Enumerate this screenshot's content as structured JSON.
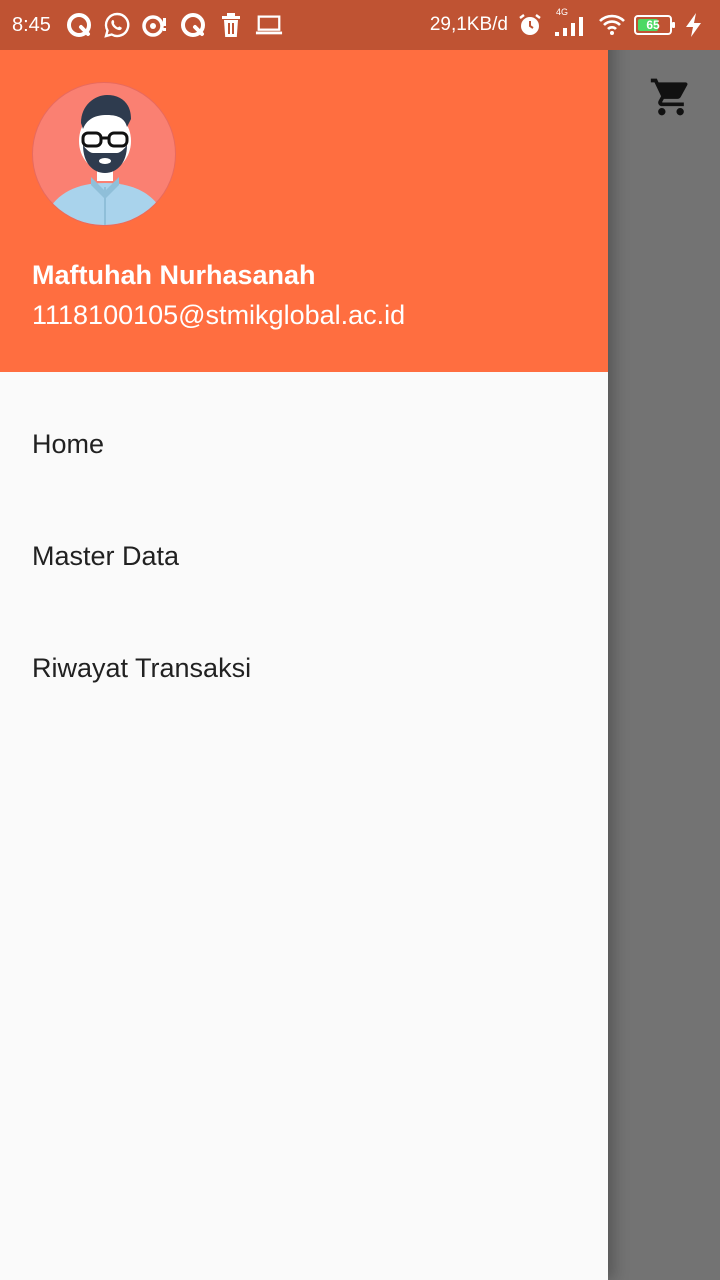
{
  "status_bar": {
    "time": "8:45",
    "net_speed": "29,1KB/d",
    "network_type": "4G",
    "battery_level": "65",
    "battery_fraction": 0.65,
    "notification_icons": [
      "q-app-icon",
      "whatsapp-icon",
      "sync-alert-icon",
      "q-app-icon",
      "trash-icon",
      "laptop-icon"
    ],
    "right_icons": [
      "alarm-icon",
      "signal-icon",
      "wifi-icon",
      "battery-icon",
      "charging-bolt-icon"
    ]
  },
  "background_app": {
    "icons": [
      "cart-icon"
    ]
  },
  "drawer": {
    "header": {
      "avatar_icon": "user-avatar",
      "name": "Maftuhah Nurhasanah",
      "email": "1118100105@stmikglobal.ac.id"
    },
    "menu_items": [
      {
        "label": "Home"
      },
      {
        "label": "Master Data"
      },
      {
        "label": "Riwayat Transaksi"
      }
    ]
  },
  "colors": {
    "status_bar": "#bf5333",
    "header_accent": "#ff6e40",
    "drawer_bg": "#fafafa",
    "scrim": "#737373",
    "menu_text": "#212121",
    "avatar_bg": "#fa8072",
    "battery_green": "#4cd964"
  }
}
